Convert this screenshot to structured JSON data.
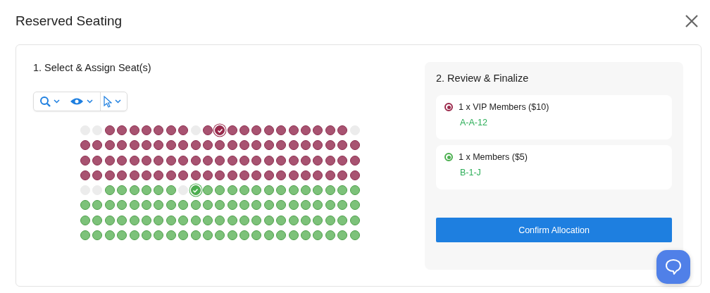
{
  "window": {
    "title": "Reserved Seating"
  },
  "select_section": {
    "title": "1. Select & Assign Seat(s)",
    "seat_rows": [
      {
        "seats": [
          {
            "kind": "unavailable",
            "selected": false
          },
          {
            "kind": "unavailable",
            "selected": false
          },
          {
            "kind": "vip",
            "selected": false
          },
          {
            "kind": "vip",
            "selected": false
          },
          {
            "kind": "vip",
            "selected": false
          },
          {
            "kind": "vip",
            "selected": false
          },
          {
            "kind": "vip",
            "selected": false
          },
          {
            "kind": "vip",
            "selected": false
          },
          {
            "kind": "vip",
            "selected": false
          },
          {
            "kind": "unavailable",
            "selected": false
          },
          {
            "kind": "vip",
            "selected": false
          },
          {
            "kind": "vip",
            "selected": true
          },
          {
            "kind": "vip",
            "selected": false
          },
          {
            "kind": "vip",
            "selected": false
          },
          {
            "kind": "vip",
            "selected": false
          },
          {
            "kind": "vip",
            "selected": false
          },
          {
            "kind": "vip",
            "selected": false
          },
          {
            "kind": "vip",
            "selected": false
          },
          {
            "kind": "vip",
            "selected": false
          },
          {
            "kind": "vip",
            "selected": false
          },
          {
            "kind": "vip",
            "selected": false
          },
          {
            "kind": "vip",
            "selected": false
          },
          {
            "kind": "unavailable",
            "selected": false
          }
        ]
      },
      {
        "seats": [
          {
            "kind": "vip",
            "selected": false
          },
          {
            "kind": "vip",
            "selected": false
          },
          {
            "kind": "vip",
            "selected": false
          },
          {
            "kind": "vip",
            "selected": false
          },
          {
            "kind": "vip",
            "selected": false
          },
          {
            "kind": "vip",
            "selected": false
          },
          {
            "kind": "vip",
            "selected": false
          },
          {
            "kind": "vip",
            "selected": false
          },
          {
            "kind": "vip",
            "selected": false
          },
          {
            "kind": "vip",
            "selected": false
          },
          {
            "kind": "vip",
            "selected": false
          },
          {
            "kind": "vip",
            "selected": false
          },
          {
            "kind": "vip",
            "selected": false
          },
          {
            "kind": "vip",
            "selected": false
          },
          {
            "kind": "vip",
            "selected": false
          },
          {
            "kind": "vip",
            "selected": false
          },
          {
            "kind": "vip",
            "selected": false
          },
          {
            "kind": "vip",
            "selected": false
          },
          {
            "kind": "vip",
            "selected": false
          },
          {
            "kind": "vip",
            "selected": false
          },
          {
            "kind": "vip",
            "selected": false
          },
          {
            "kind": "vip",
            "selected": false
          },
          {
            "kind": "vip",
            "selected": false
          }
        ]
      },
      {
        "seats": [
          {
            "kind": "vip",
            "selected": false
          },
          {
            "kind": "vip",
            "selected": false
          },
          {
            "kind": "vip",
            "selected": false
          },
          {
            "kind": "vip",
            "selected": false
          },
          {
            "kind": "vip",
            "selected": false
          },
          {
            "kind": "vip",
            "selected": false
          },
          {
            "kind": "vip",
            "selected": false
          },
          {
            "kind": "vip",
            "selected": false
          },
          {
            "kind": "vip",
            "selected": false
          },
          {
            "kind": "vip",
            "selected": false
          },
          {
            "kind": "vip",
            "selected": false
          },
          {
            "kind": "vip",
            "selected": false
          },
          {
            "kind": "vip",
            "selected": false
          },
          {
            "kind": "vip",
            "selected": false
          },
          {
            "kind": "vip",
            "selected": false
          },
          {
            "kind": "vip",
            "selected": false
          },
          {
            "kind": "vip",
            "selected": false
          },
          {
            "kind": "vip",
            "selected": false
          },
          {
            "kind": "vip",
            "selected": false
          },
          {
            "kind": "vip",
            "selected": false
          },
          {
            "kind": "vip",
            "selected": false
          },
          {
            "kind": "vip",
            "selected": false
          },
          {
            "kind": "vip",
            "selected": false
          }
        ]
      },
      {
        "seats": [
          {
            "kind": "vip",
            "selected": false
          },
          {
            "kind": "vip",
            "selected": false
          },
          {
            "kind": "vip",
            "selected": false
          },
          {
            "kind": "vip",
            "selected": false
          },
          {
            "kind": "vip",
            "selected": false
          },
          {
            "kind": "vip",
            "selected": false
          },
          {
            "kind": "vip",
            "selected": false
          },
          {
            "kind": "vip",
            "selected": false
          },
          {
            "kind": "vip",
            "selected": false
          },
          {
            "kind": "vip",
            "selected": false
          },
          {
            "kind": "vip",
            "selected": false
          },
          {
            "kind": "vip",
            "selected": false
          },
          {
            "kind": "vip",
            "selected": false
          },
          {
            "kind": "vip",
            "selected": false
          },
          {
            "kind": "vip",
            "selected": false
          },
          {
            "kind": "vip",
            "selected": false
          },
          {
            "kind": "vip",
            "selected": false
          },
          {
            "kind": "vip",
            "selected": false
          },
          {
            "kind": "vip",
            "selected": false
          },
          {
            "kind": "vip",
            "selected": false
          },
          {
            "kind": "vip",
            "selected": false
          },
          {
            "kind": "vip",
            "selected": false
          },
          {
            "kind": "vip",
            "selected": false
          }
        ]
      },
      {
        "seats": [
          {
            "kind": "unavailable",
            "selected": false
          },
          {
            "kind": "unavailable",
            "selected": false
          },
          {
            "kind": "member",
            "selected": false
          },
          {
            "kind": "member",
            "selected": false
          },
          {
            "kind": "member",
            "selected": false
          },
          {
            "kind": "member",
            "selected": false
          },
          {
            "kind": "member",
            "selected": false
          },
          {
            "kind": "member",
            "selected": false
          },
          {
            "kind": "unavailable",
            "selected": false
          },
          {
            "kind": "member",
            "selected": true
          },
          {
            "kind": "member",
            "selected": false
          },
          {
            "kind": "member",
            "selected": false
          },
          {
            "kind": "member",
            "selected": false
          },
          {
            "kind": "member",
            "selected": false
          },
          {
            "kind": "member",
            "selected": false
          },
          {
            "kind": "member",
            "selected": false
          },
          {
            "kind": "member",
            "selected": false
          },
          {
            "kind": "member",
            "selected": false
          },
          {
            "kind": "member",
            "selected": false
          },
          {
            "kind": "member",
            "selected": false
          },
          {
            "kind": "member",
            "selected": false
          },
          {
            "kind": "member",
            "selected": false
          },
          {
            "kind": "member",
            "selected": false
          }
        ]
      },
      {
        "seats": [
          {
            "kind": "member",
            "selected": false
          },
          {
            "kind": "member",
            "selected": false
          },
          {
            "kind": "member",
            "selected": false
          },
          {
            "kind": "member",
            "selected": false
          },
          {
            "kind": "member",
            "selected": false
          },
          {
            "kind": "member",
            "selected": false
          },
          {
            "kind": "member",
            "selected": false
          },
          {
            "kind": "member",
            "selected": false
          },
          {
            "kind": "member",
            "selected": false
          },
          {
            "kind": "member",
            "selected": false
          },
          {
            "kind": "member",
            "selected": false
          },
          {
            "kind": "member",
            "selected": false
          },
          {
            "kind": "member",
            "selected": false
          },
          {
            "kind": "member",
            "selected": false
          },
          {
            "kind": "member",
            "selected": false
          },
          {
            "kind": "member",
            "selected": false
          },
          {
            "kind": "member",
            "selected": false
          },
          {
            "kind": "member",
            "selected": false
          },
          {
            "kind": "member",
            "selected": false
          },
          {
            "kind": "member",
            "selected": false
          },
          {
            "kind": "member",
            "selected": false
          },
          {
            "kind": "member",
            "selected": false
          },
          {
            "kind": "member",
            "selected": false
          }
        ]
      },
      {
        "seats": [
          {
            "kind": "member",
            "selected": false
          },
          {
            "kind": "member",
            "selected": false
          },
          {
            "kind": "member",
            "selected": false
          },
          {
            "kind": "member",
            "selected": false
          },
          {
            "kind": "member",
            "selected": false
          },
          {
            "kind": "member",
            "selected": false
          },
          {
            "kind": "member",
            "selected": false
          },
          {
            "kind": "member",
            "selected": false
          },
          {
            "kind": "member",
            "selected": false
          },
          {
            "kind": "member",
            "selected": false
          },
          {
            "kind": "member",
            "selected": false
          },
          {
            "kind": "member",
            "selected": false
          },
          {
            "kind": "member",
            "selected": false
          },
          {
            "kind": "member",
            "selected": false
          },
          {
            "kind": "member",
            "selected": false
          },
          {
            "kind": "member",
            "selected": false
          },
          {
            "kind": "member",
            "selected": false
          },
          {
            "kind": "member",
            "selected": false
          },
          {
            "kind": "member",
            "selected": false
          },
          {
            "kind": "member",
            "selected": false
          },
          {
            "kind": "member",
            "selected": false
          },
          {
            "kind": "member",
            "selected": false
          },
          {
            "kind": "member",
            "selected": false
          }
        ]
      },
      {
        "seats": [
          {
            "kind": "member",
            "selected": false
          },
          {
            "kind": "member",
            "selected": false
          },
          {
            "kind": "member",
            "selected": false
          },
          {
            "kind": "member",
            "selected": false
          },
          {
            "kind": "member",
            "selected": false
          },
          {
            "kind": "member",
            "selected": false
          },
          {
            "kind": "member",
            "selected": false
          },
          {
            "kind": "member",
            "selected": false
          },
          {
            "kind": "member",
            "selected": false
          },
          {
            "kind": "member",
            "selected": false
          },
          {
            "kind": "member",
            "selected": false
          },
          {
            "kind": "member",
            "selected": false
          },
          {
            "kind": "member",
            "selected": false
          },
          {
            "kind": "member",
            "selected": false
          },
          {
            "kind": "member",
            "selected": false
          },
          {
            "kind": "member",
            "selected": false
          },
          {
            "kind": "member",
            "selected": false
          },
          {
            "kind": "member",
            "selected": false
          },
          {
            "kind": "member",
            "selected": false
          },
          {
            "kind": "member",
            "selected": false
          },
          {
            "kind": "member",
            "selected": false
          },
          {
            "kind": "member",
            "selected": false
          },
          {
            "kind": "member",
            "selected": false
          }
        ]
      }
    ]
  },
  "review_section": {
    "title": "2. Review & Finalize",
    "items": [
      {
        "label": "1 x VIP Members ($10)",
        "color": "#9b2a4c",
        "seat": "A-A-12"
      },
      {
        "label": "1 x Members ($5)",
        "color": "#4caf50",
        "seat": "B-1-J"
      }
    ],
    "confirm_button": "Confirm Allocation"
  }
}
